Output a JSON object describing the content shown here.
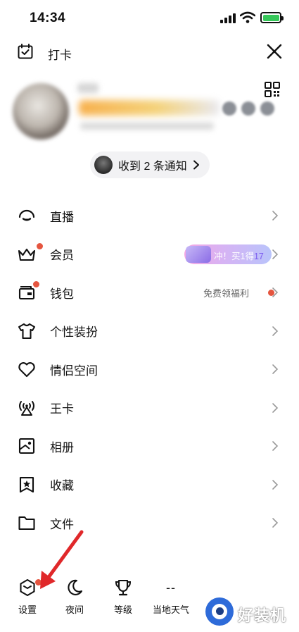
{
  "status_bar": {
    "time": "14:34"
  },
  "top_bar": {
    "checkin_label": "打卡"
  },
  "notification": {
    "text": "收到 2 条通知"
  },
  "menu": {
    "items": [
      {
        "label": "直播",
        "icon": "live-icon"
      },
      {
        "label": "会员",
        "icon": "crown-icon",
        "has_dot": true,
        "promo": {
          "prefix": "冲！买1得",
          "number": "17"
        }
      },
      {
        "label": "钱包",
        "icon": "wallet-icon",
        "has_dot": true,
        "tip": "免费领福利"
      },
      {
        "label": "个性装扮",
        "icon": "tshirt-icon"
      },
      {
        "label": "情侣空间",
        "icon": "heart-icon"
      },
      {
        "label": "王卡",
        "icon": "signal-tower-icon"
      },
      {
        "label": "相册",
        "icon": "photo-album-icon"
      },
      {
        "label": "收藏",
        "icon": "favorites-icon"
      },
      {
        "label": "文件",
        "icon": "folder-icon"
      }
    ]
  },
  "bottom_bar": {
    "items": [
      {
        "label": "设置",
        "icon": "settings-icon"
      },
      {
        "label": "夜间",
        "icon": "moon-icon"
      },
      {
        "label": "等级",
        "icon": "trophy-icon"
      },
      {
        "label": "当地天气",
        "value": "--"
      }
    ]
  },
  "watermark": {
    "text": "好装机"
  },
  "colors": {
    "accent_red": "#e5553f",
    "battery_green": "#35c759",
    "watermark_blue": "#2e6bd9"
  }
}
